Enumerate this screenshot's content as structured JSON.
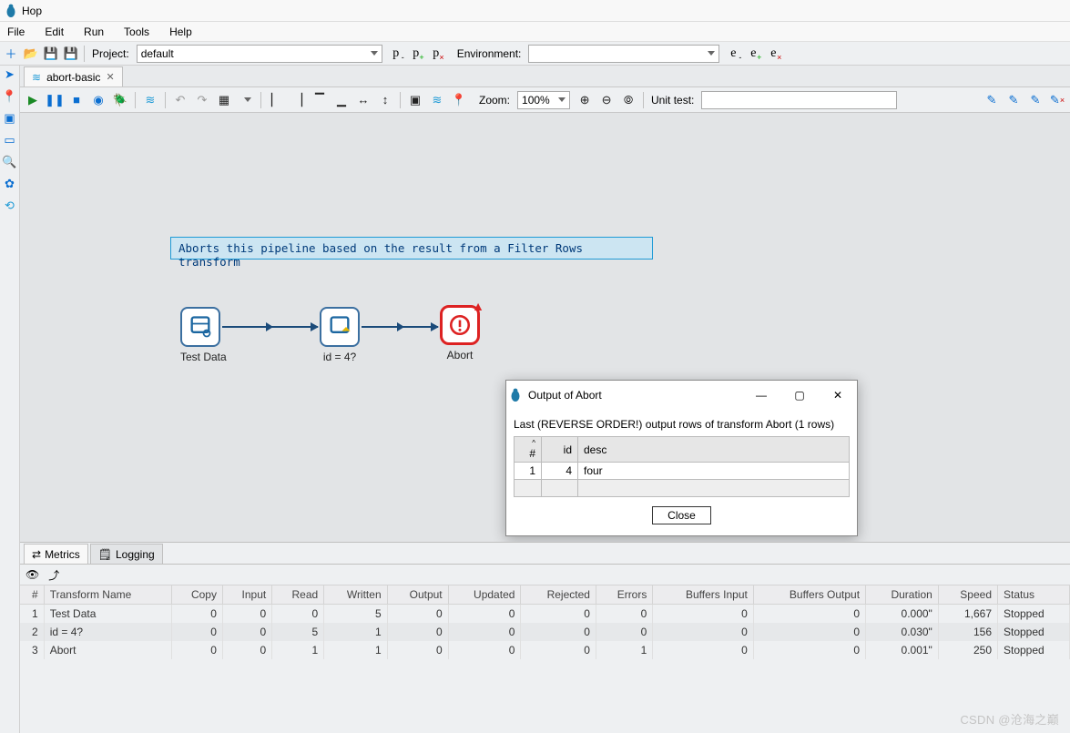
{
  "app": {
    "title": "Hop"
  },
  "menu": [
    "File",
    "Edit",
    "Run",
    "Tools",
    "Help"
  ],
  "toolbar": {
    "project_label": "Project:",
    "project_value": "default",
    "environment_label": "Environment:",
    "environment_value": ""
  },
  "tab": {
    "name": "abort-basic"
  },
  "toolbar2": {
    "zoom_label": "Zoom:",
    "zoom_value": "100%",
    "unit_test_label": "Unit test:",
    "unit_test_value": ""
  },
  "canvas": {
    "note": "Aborts this pipeline based on the result from a Filter Rows transform",
    "nodes": {
      "test_data": "Test Data",
      "filter": "id = 4?",
      "abort": "Abort"
    }
  },
  "dialog": {
    "title": "Output of Abort",
    "message": "Last (REVERSE ORDER!) output rows of transform Abort (1 rows)",
    "headers": [
      "#",
      "id",
      "desc"
    ],
    "row_num": "1",
    "row_id": "4",
    "row_desc": "four",
    "close": "Close"
  },
  "panel": {
    "tabs": [
      "Metrics",
      "Logging"
    ],
    "headers": [
      "#",
      "Transform Name",
      "Copy",
      "Input",
      "Read",
      "Written",
      "Output",
      "Updated",
      "Rejected",
      "Errors",
      "Buffers Input",
      "Buffers Output",
      "Duration",
      "Speed",
      "Status"
    ],
    "rows": [
      {
        "n": "1",
        "name": "Test Data",
        "copy": "0",
        "input": "0",
        "read": "0",
        "written": "5",
        "output": "0",
        "updated": "0",
        "rejected": "0",
        "errors": "0",
        "bin": "0",
        "bout": "0",
        "dur": "0.000\"",
        "speed": "1,667",
        "status": "Stopped"
      },
      {
        "n": "2",
        "name": "id = 4?",
        "copy": "0",
        "input": "0",
        "read": "5",
        "written": "1",
        "output": "0",
        "updated": "0",
        "rejected": "0",
        "errors": "0",
        "bin": "0",
        "bout": "0",
        "dur": "0.030\"",
        "speed": "156",
        "status": "Stopped"
      },
      {
        "n": "3",
        "name": "Abort",
        "copy": "0",
        "input": "0",
        "read": "1",
        "written": "1",
        "output": "0",
        "updated": "0",
        "rejected": "0",
        "errors": "1",
        "bin": "0",
        "bout": "0",
        "dur": "0.001\"",
        "speed": "250",
        "status": "Stopped"
      }
    ]
  },
  "watermark": "CSDN @沧海之巅"
}
